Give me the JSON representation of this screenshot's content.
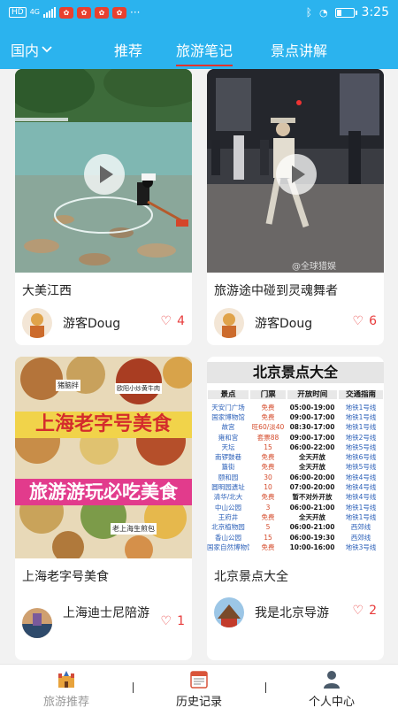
{
  "status_bar": {
    "hd": "HD",
    "network": "4G",
    "more": "···",
    "time": "3:25"
  },
  "top_nav": {
    "region": "国内",
    "tabs": [
      {
        "label": "推荐",
        "active": false
      },
      {
        "label": "旅游笔记",
        "active": true
      },
      {
        "label": "景点讲解",
        "active": false
      }
    ]
  },
  "cards": [
    {
      "title": "大美江西",
      "author": "游客Doug",
      "likes": "4",
      "type": "video"
    },
    {
      "title": "旅游途中碰到灵魂舞者",
      "author": "游客Doug",
      "likes": "6",
      "type": "video",
      "watermark": "@全球猎娱"
    },
    {
      "title": "上海老字号美食",
      "author": "上海迪士尼陪游",
      "likes": "1",
      "type": "image",
      "image_text": {
        "top_label": "猪脑拌",
        "chip_1": "欧阳小炒黄牛肉",
        "banner_1": "上海老字号美食",
        "banner_2": "旅游游玩必吃美食",
        "chip_2": "老上海生煎包"
      }
    },
    {
      "title": "北京景点大全",
      "author": "我是北京导游",
      "likes": "2",
      "type": "image",
      "image_text": {
        "heading": "北京景点大全",
        "headers": [
          "景点",
          "门票",
          "开放时间",
          "交通指南"
        ],
        "rows": [
          [
            "天安门广场",
            "免费",
            "05:00-19:00",
            "地铁1号线"
          ],
          [
            "国家博物馆",
            "免费",
            "09:00-17:00",
            "地铁1号线"
          ],
          [
            "故宫",
            "旺60/淡40",
            "08:30-17:00",
            "地铁1号线"
          ],
          [
            "雍和宫",
            "套票88",
            "09:00-17:00",
            "地铁2号线"
          ],
          [
            "天坛",
            "15",
            "06:00-22:00",
            "地铁5号线"
          ],
          [
            "南锣鼓巷",
            "免费",
            "全天开放",
            "地铁6号线"
          ],
          [
            "簋街",
            "免费",
            "全天开放",
            "地铁5号线"
          ],
          [
            "颐和园",
            "30",
            "06:00-20:00",
            "地铁4号线"
          ],
          [
            "圆明园遗址",
            "10",
            "07:00-20:00",
            "地铁4号线"
          ],
          [
            "清华/北大",
            "免费",
            "暂不对外开放",
            "地铁4号线"
          ],
          [
            "中山公园",
            "3",
            "06:00-21:00",
            "地铁1号线"
          ],
          [
            "王府井",
            "免费",
            "全天开放",
            "地铁1号线"
          ],
          [
            "北京植物园",
            "5",
            "06:00-21:00",
            "西郊线"
          ],
          [
            "香山公园",
            "15",
            "06:00-19:30",
            "西郊线"
          ],
          [
            "国家自然博物馆",
            "免费",
            "10:00-16:00",
            "地铁3号线"
          ]
        ]
      }
    }
  ],
  "bottom_nav": [
    {
      "label": "旅游推荐",
      "icon": "castle-icon",
      "active": true
    },
    {
      "label": "历史记录",
      "icon": "calendar-icon",
      "active": false
    },
    {
      "label": "个人中心",
      "icon": "user-icon",
      "active": false
    }
  ],
  "colors": {
    "primary": "#2bb3ee",
    "tab_underline": "#e2332d",
    "like": "#e83c3c"
  }
}
